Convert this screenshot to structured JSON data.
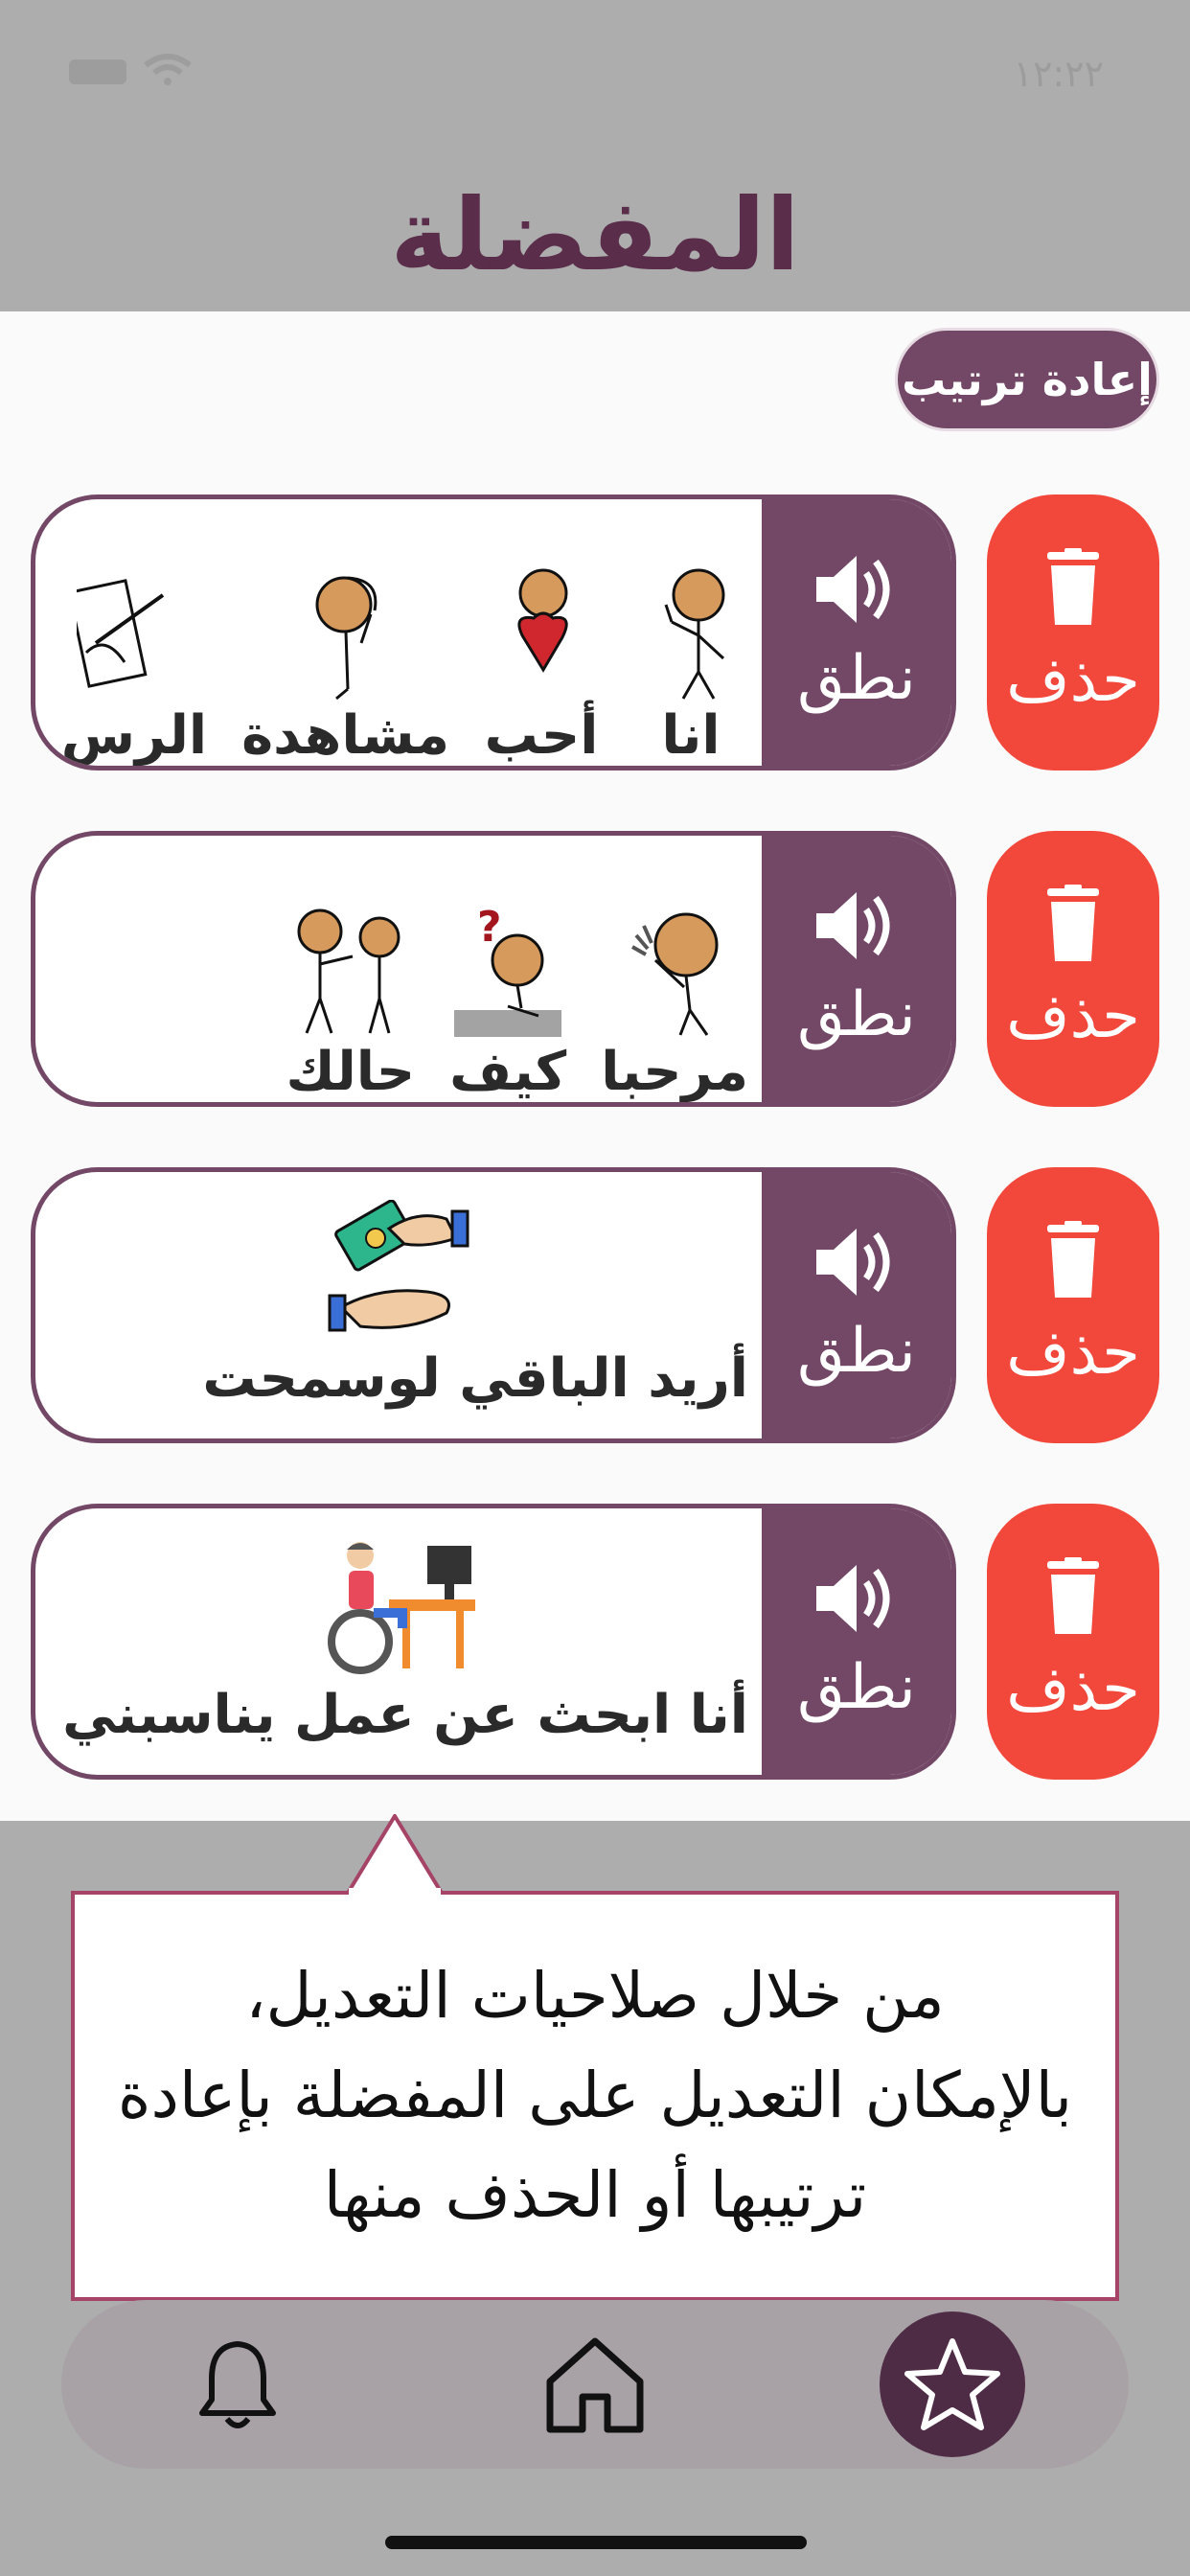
{
  "status_bar": {
    "time": "١٢:٢٢"
  },
  "header": {
    "title": "المفضلة"
  },
  "reorder_button": {
    "label": "إعادة ترتيب"
  },
  "actions": {
    "delete_label": "حذف",
    "speak_label": "نطق"
  },
  "favorites": [
    {
      "words": [
        "انا",
        "أحب",
        "مشاهدة",
        "الرس"
      ]
    },
    {
      "words": [
        "مرحبا",
        "كيف",
        "حالك"
      ]
    },
    {
      "phrase": "أريد الباقي لوسمحت"
    },
    {
      "phrase": "أنا ابحث عن عمل يناسبني"
    }
  ],
  "tooltip": {
    "line1": "من خلال صلاحيات التعديل،",
    "line2": "بالإمكان التعديل على المفضلة بإعادة",
    "line3": "ترتيبها أو الحذف منها"
  },
  "bottom_nav": {
    "items": [
      "bell-icon",
      "home-icon",
      "star-icon"
    ],
    "active": "star-icon"
  },
  "colors": {
    "primary": "#734866",
    "delete": "#f2473b",
    "title": "#5a2d4b",
    "tooltip_border": "#a54466"
  }
}
